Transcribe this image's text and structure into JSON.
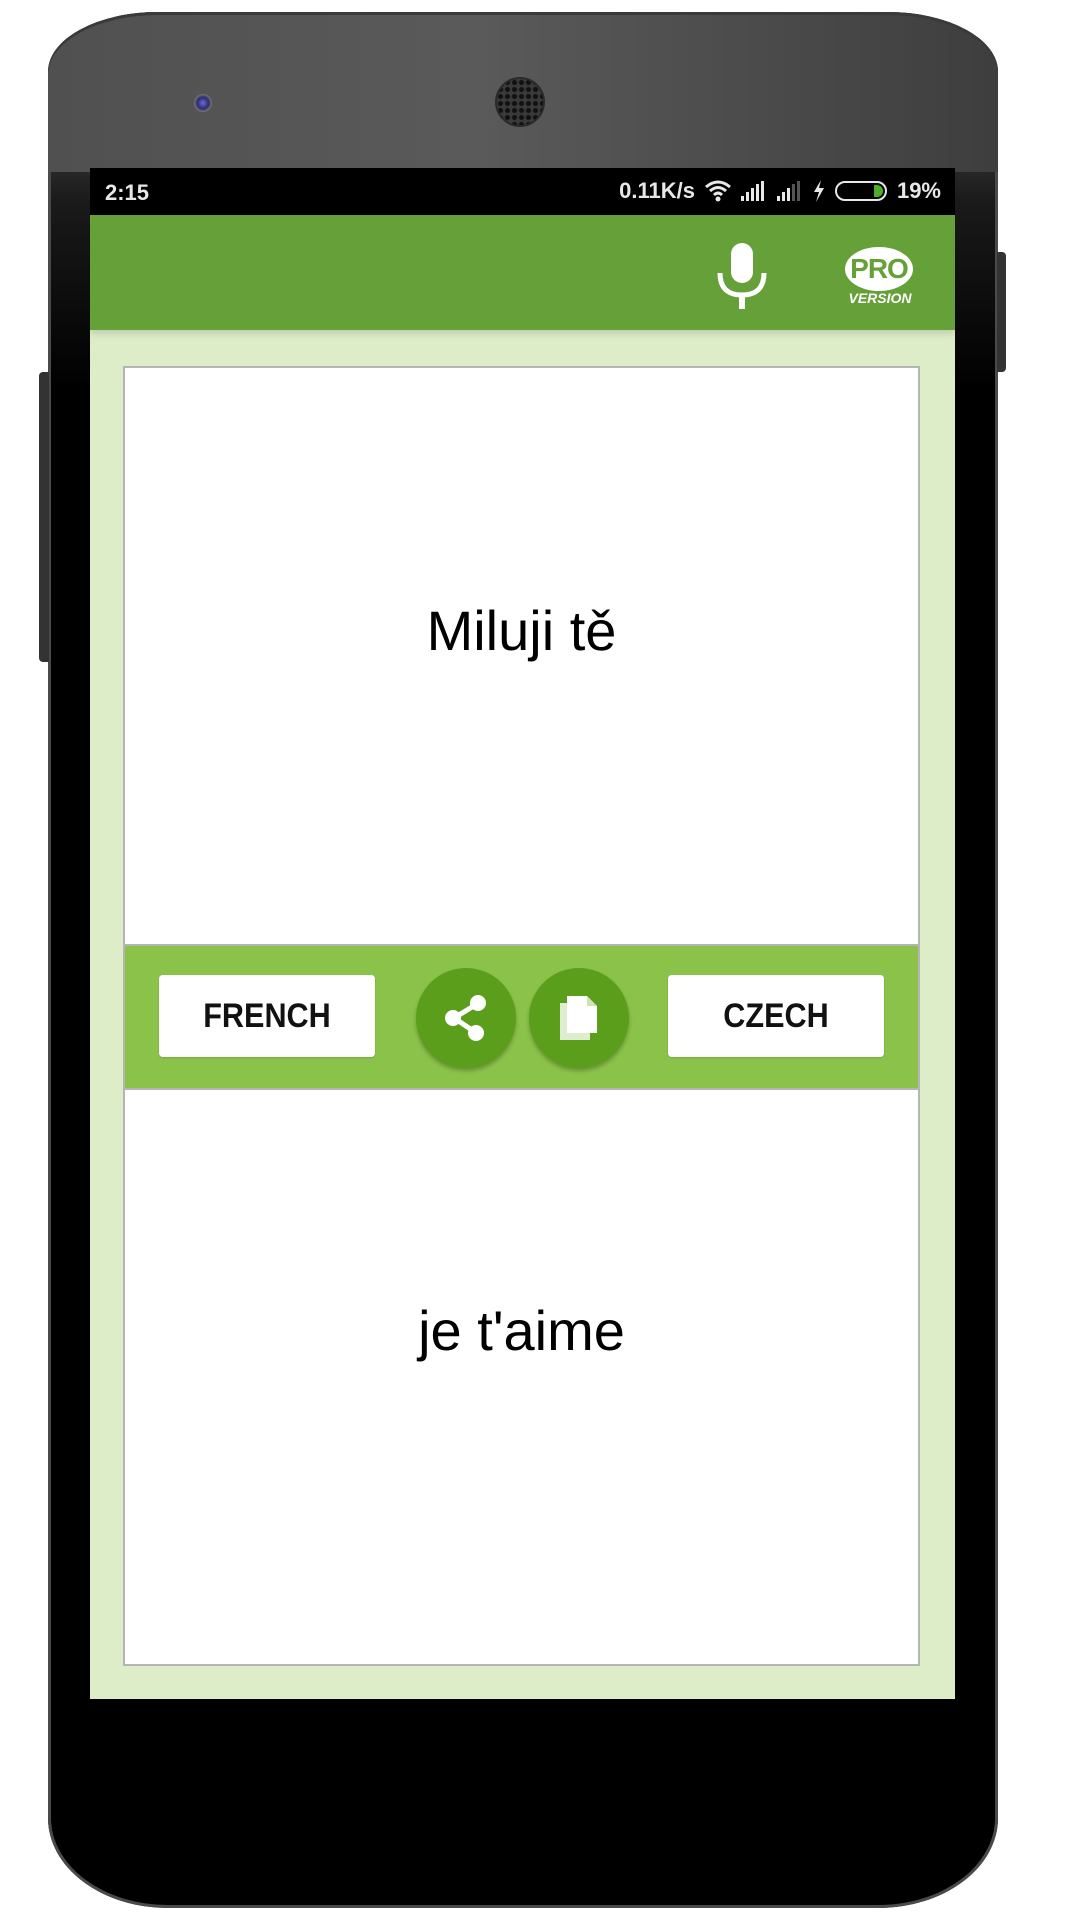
{
  "status_bar": {
    "time": "2:15",
    "network_speed": "0.11K/s",
    "icons": [
      "wifi-icon",
      "signal-icon",
      "signal-icon",
      "charging-icon",
      "battery-icon"
    ],
    "battery_percent": "19%"
  },
  "toolbar": {
    "mic_icon": "microphone-icon",
    "pro_badge": {
      "top": "PRO",
      "bottom": "VERSION"
    }
  },
  "translation": {
    "source_text": "Miluji tě",
    "target_text": "je t'aime"
  },
  "language_bar": {
    "left_language": "FRENCH",
    "right_language": "CZECH",
    "share_icon": "share-icon",
    "copy_icon": "copy-icon"
  },
  "colors": {
    "toolbar": "#65a038",
    "language_bar": "#8bc34a",
    "action_circle": "#5b9e1b",
    "background": "#dcedc8"
  }
}
